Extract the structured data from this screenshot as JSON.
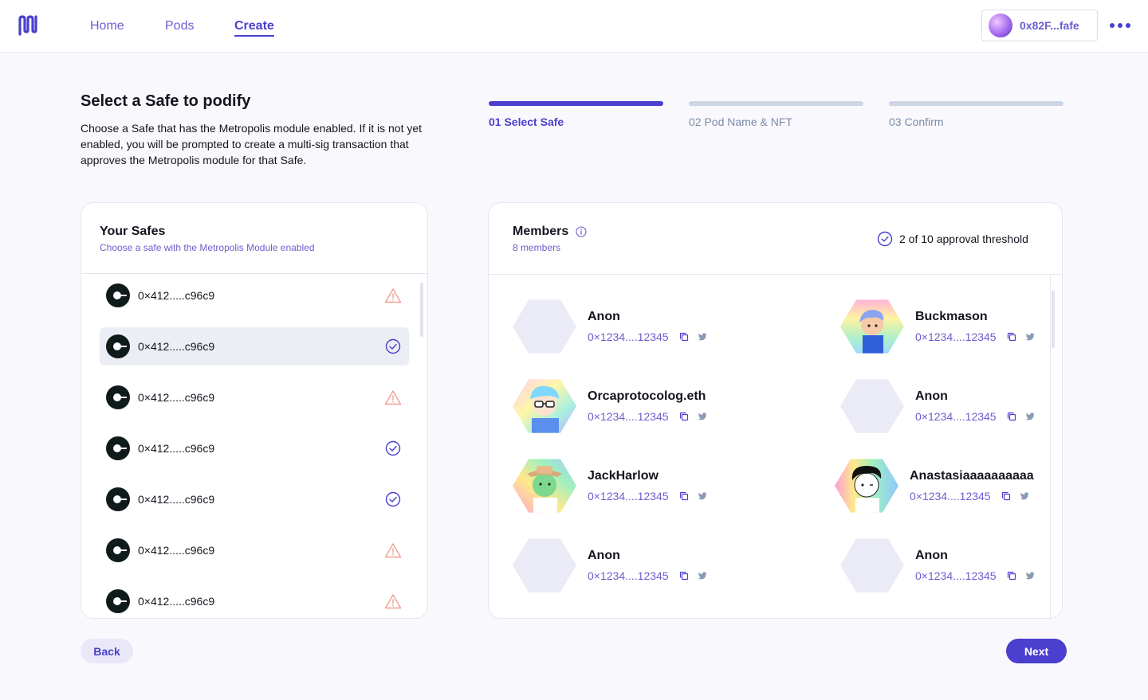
{
  "nav": {
    "items": [
      {
        "label": "Home",
        "active": false
      },
      {
        "label": "Pods",
        "active": false
      },
      {
        "label": "Create",
        "active": true
      }
    ],
    "wallet_address": "0x82F...fafe",
    "logo_icon": "metropolis-logo-icon",
    "more_icon": "more-dots-icon"
  },
  "header": {
    "title": "Select a Safe to podify",
    "description": "Choose a Safe that has the Metropolis module enabled. If it is not yet enabled, you will be prompted to create a multi-sig transaction that approves the Metropolis module for that Safe."
  },
  "steps": [
    {
      "label": "01 Select Safe",
      "active": true
    },
    {
      "label": "02 Pod Name & NFT",
      "active": false
    },
    {
      "label": "03 Confirm",
      "active": false
    }
  ],
  "safes": {
    "title": "Your Safes",
    "subtitle": "Choose a safe with the Metropolis Module enabled",
    "items": [
      {
        "address": "0×412.....c96c9",
        "status": "warning",
        "selected": false
      },
      {
        "address": "0×412.....c96c9",
        "status": "enabled",
        "selected": true
      },
      {
        "address": "0×412.....c96c9",
        "status": "warning",
        "selected": false
      },
      {
        "address": "0×412.....c96c9",
        "status": "enabled",
        "selected": false
      },
      {
        "address": "0×412.....c96c9",
        "status": "enabled",
        "selected": false
      },
      {
        "address": "0×412.....c96c9",
        "status": "warning",
        "selected": false
      },
      {
        "address": "0×412.....c96c9",
        "status": "warning",
        "selected": false
      }
    ]
  },
  "members": {
    "title": "Members",
    "count_label": "8 members",
    "threshold_label": "2 of 10 approval threshold",
    "items": [
      {
        "name": "Anon",
        "address": "0×1234....12345",
        "avatar": "anon"
      },
      {
        "name": "Buckmason",
        "address": "0×1234....12345",
        "avatar": "pfp-blue-hair"
      },
      {
        "name": "Orcaprotocolog.eth",
        "address": "0×1234....12345",
        "avatar": "pfp-glasses"
      },
      {
        "name": "Anon",
        "address": "0×1234....12345",
        "avatar": "anon"
      },
      {
        "name": "JackHarlow",
        "address": "0×1234....12345",
        "avatar": "pfp-cowboy"
      },
      {
        "name": "Anastasiaaaaaaaaaa",
        "address": "0×1234....12345",
        "avatar": "pfp-curly"
      },
      {
        "name": "Anon",
        "address": "0×1234....12345",
        "avatar": "anon"
      },
      {
        "name": "Anon",
        "address": "0×1234....12345",
        "avatar": "anon"
      }
    ]
  },
  "actions": {
    "back_label": "Back",
    "next_label": "Next"
  },
  "colors": {
    "accent": "#4a3fcf",
    "warning": "#f0a090",
    "step_inactive": "#ccd6e4"
  }
}
